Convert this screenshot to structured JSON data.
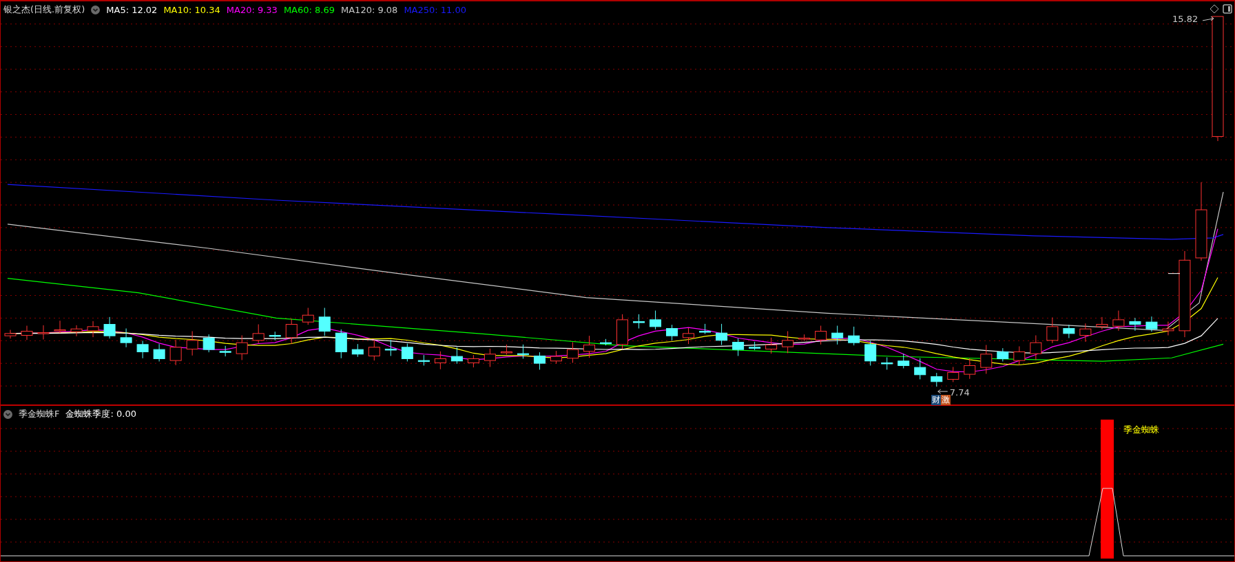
{
  "title": "银之杰(日线.前复权)",
  "ma_labels": [
    {
      "text": "MA5: 12.02",
      "color": "#ffffff"
    },
    {
      "text": "MA10: 10.34",
      "color": "#ffff00"
    },
    {
      "text": "MA20: 9.33",
      "color": "#ff00ff"
    },
    {
      "text": "MA60: 8.69",
      "color": "#00ff00"
    },
    {
      "text": "MA120: 9.08",
      "color": "#c8c8c8"
    },
    {
      "text": "MA250: 11.00",
      "color": "#1a1aff"
    }
  ],
  "price_marks": [
    {
      "kind": "high",
      "text": "15.82"
    },
    {
      "kind": "low",
      "text": "7.74"
    }
  ],
  "event_badges": [
    {
      "text": "财",
      "color": "#1c4a78"
    },
    {
      "text": "激",
      "color": "#c0521c"
    }
  ],
  "indicator": {
    "name": "季金蜘蛛F",
    "value_label": "金蜘蛛季度: 0.00",
    "signal_label": "季金蜘蛛"
  }
}
